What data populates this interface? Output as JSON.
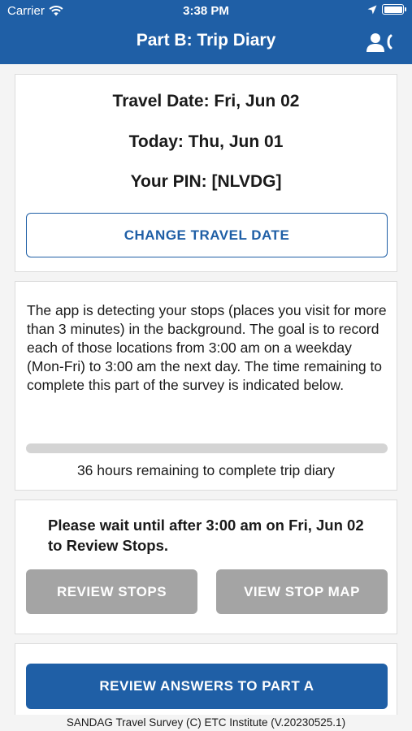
{
  "status_bar": {
    "carrier": "Carrier",
    "time": "3:38 PM",
    "wifi_icon": "wifi-icon",
    "location_icon": "location-arrow-icon",
    "battery_icon": "battery-icon"
  },
  "header": {
    "title": "Part B: Trip Diary",
    "contact_icon": "contact-support-icon",
    "background_color": "#1f5fa6"
  },
  "date_card": {
    "travel_date": "Travel Date: Fri, Jun 02",
    "today": "Today: Thu, Jun 01",
    "pin": "Your PIN: [NLVDG]",
    "change_button": "CHANGE TRAVEL DATE"
  },
  "info_card": {
    "description": "The app is detecting your stops (places you visit for more than 3 minutes) in the background. The goal is to record each of those locations from 3:00 am on a weekday (Mon-Fri) to 3:00 am the next day. The time remaining to complete this part of the survey is indicated below.",
    "progress_fraction": 0,
    "remaining": "36 hours remaining to complete trip diary"
  },
  "review_card": {
    "wait_message": "Please wait until after 3:00 am on Fri, Jun 02 to Review Stops.",
    "review_stops_button": "REVIEW STOPS",
    "view_map_button": "VIEW STOP MAP",
    "disabled_color": "#a4a4a4"
  },
  "part_a_card": {
    "review_answers_button": "REVIEW ANSWERS TO PART A"
  },
  "footer": {
    "text": "SANDAG Travel Survey (C) ETC Institute (V.20230525.1)"
  }
}
